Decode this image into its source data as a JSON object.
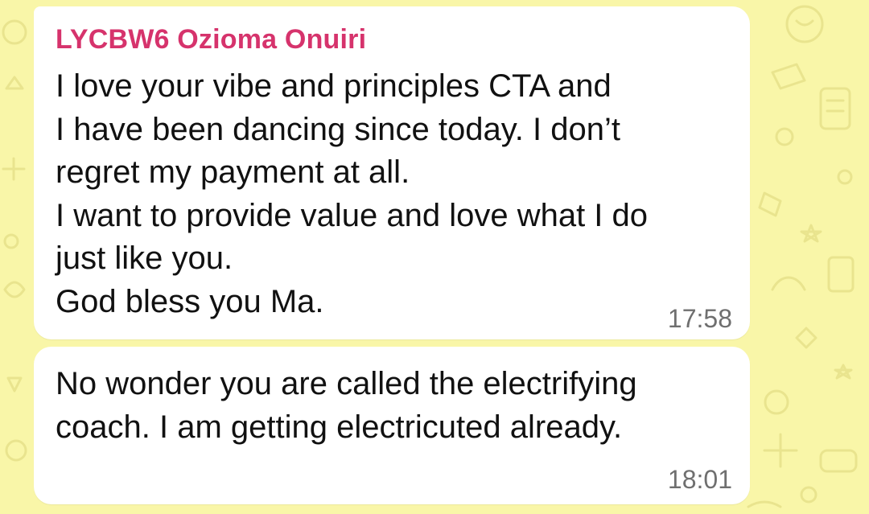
{
  "chat": {
    "background_color": "#f9f6a8",
    "bubble_color": "#ffffff",
    "sender_color": "#d6336c"
  },
  "messages": [
    {
      "sender": "LYCBW6 Ozioma Onuiri",
      "lines": [
        "I love your vibe and principles  CTA and",
        "I have been dancing since today. I don’t",
        "regret my payment at all.",
        "I want to provide value and love what I do",
        "just like you.",
        "God bless you Ma."
      ],
      "time": "17:58"
    },
    {
      "lines": [
        "No wonder you are called the electrifying",
        "coach. I am getting electricuted already."
      ],
      "time": "18:01"
    }
  ]
}
